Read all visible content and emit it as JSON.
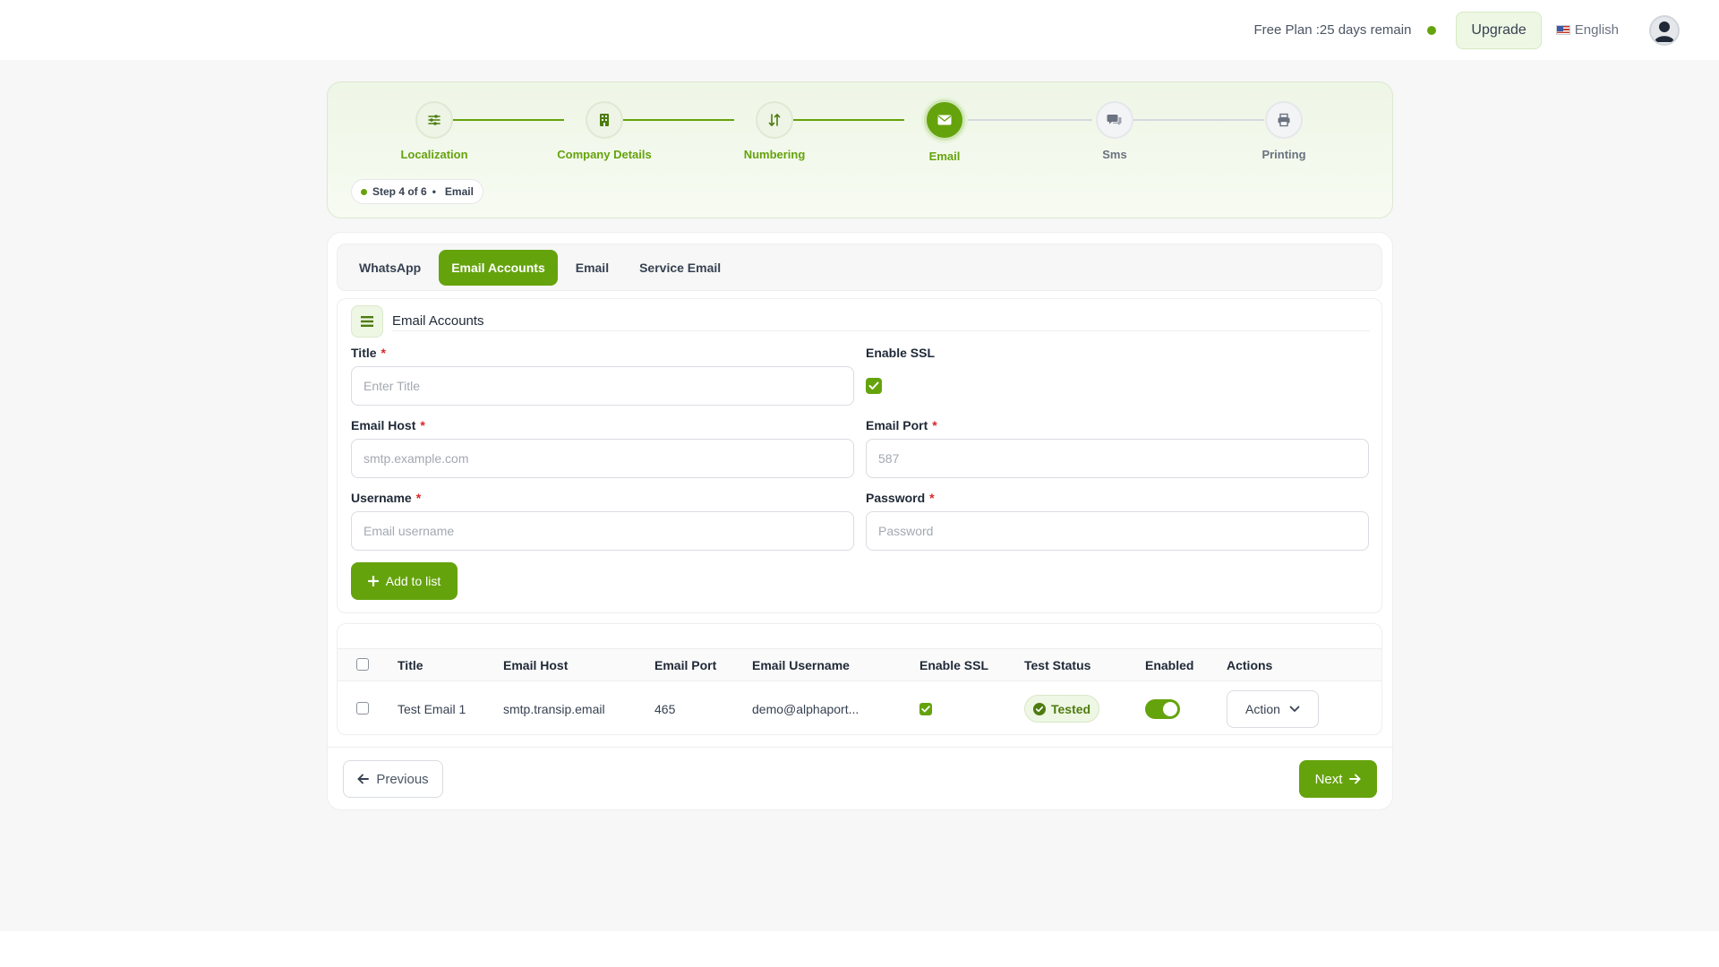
{
  "topbar": {
    "plan_text": "Free Plan :25 days remain",
    "upgrade_label": "Upgrade",
    "language_label": "English"
  },
  "stepper": {
    "steps": [
      {
        "label": "Localization",
        "icon": "sliders-icon",
        "state": "done"
      },
      {
        "label": "Company Details",
        "icon": "building-icon",
        "state": "done"
      },
      {
        "label": "Numbering",
        "icon": "sort-numeric-icon",
        "state": "done"
      },
      {
        "label": "Email",
        "icon": "envelope-icon",
        "state": "active"
      },
      {
        "label": "Sms",
        "icon": "chat-bubbles-icon",
        "state": "pending"
      },
      {
        "label": "Printing",
        "icon": "printer-icon",
        "state": "pending"
      }
    ],
    "badge_step": "Step 4 of 6",
    "badge_separator": "•",
    "badge_name": "Email"
  },
  "tabs": [
    {
      "label": "WhatsApp",
      "active": false
    },
    {
      "label": "Email Accounts",
      "active": true
    },
    {
      "label": "Email",
      "active": false
    },
    {
      "label": "Service Email",
      "active": false
    }
  ],
  "form": {
    "section_title": "Email Accounts",
    "title_label": "Title",
    "title_placeholder": "Enter Title",
    "ssl_label": "Enable SSL",
    "ssl_checked": true,
    "host_label": "Email Host",
    "host_placeholder": "smtp.example.com",
    "port_label": "Email Port",
    "port_placeholder": "587",
    "username_label": "Username",
    "username_placeholder": "Email username",
    "password_label": "Password",
    "password_placeholder": "Password",
    "required_mark": "*",
    "add_label": "Add to list"
  },
  "table": {
    "headers": [
      "Title",
      "Email Host",
      "Email Port",
      "Email Username",
      "Enable SSL",
      "Test Status",
      "Enabled",
      "Actions"
    ],
    "rows": [
      {
        "title": "Test Email 1",
        "host": "smtp.transip.email",
        "port": "465",
        "username": "demo@alphaport...",
        "ssl": true,
        "status": "Tested",
        "enabled": true,
        "action_label": "Action"
      }
    ]
  },
  "footer": {
    "previous_label": "Previous",
    "next_label": "Next"
  },
  "colors": {
    "accent": "#65a30d",
    "accent_light": "#eef6e4",
    "page_bg": "#f6f7f6"
  }
}
